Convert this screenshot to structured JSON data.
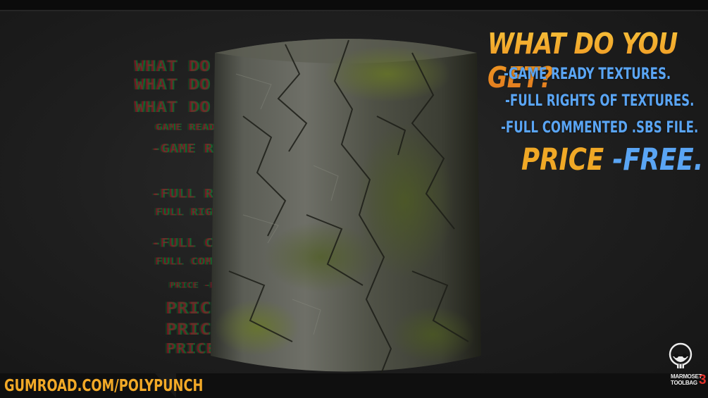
{
  "headline": "WHAT DO YOU GET?",
  "features": [
    "-GAME READY TEXTURES.",
    "-FULL RIGHTS OF TEXTURES.",
    "-FULL COMMENTED  .SBS FILE."
  ],
  "price": {
    "label": "PRICE",
    "value": "-FREE."
  },
  "gumroad_link": "GUMROAD.COM/POLYPUNCH",
  "logo": {
    "name": "MARMOSET",
    "sub": "TOOLBAG",
    "version": "3"
  },
  "colors": {
    "headline": "#f0a826",
    "feature_text": "#5aa5f4",
    "background": "#1e1e1e",
    "logo_accent": "#e0312a"
  }
}
